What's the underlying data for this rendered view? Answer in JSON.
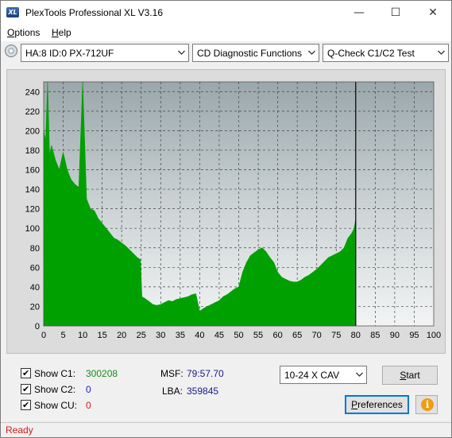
{
  "window": {
    "title": "PlexTools Professional XL V3.16",
    "icon_text": "XL",
    "controls": {
      "minimize": "—",
      "maximize": "☐",
      "close": "✕"
    }
  },
  "menu": {
    "items": [
      {
        "label_u": "O",
        "label_rest": "ptions"
      },
      {
        "label_u": "H",
        "label_rest": "elp"
      }
    ]
  },
  "toolbar": {
    "drive": "HA:8 ID:0  PX-712UF",
    "function": "CD Diagnostic Functions",
    "test": "Q-Check C1/C2 Test"
  },
  "chart_data": {
    "type": "area",
    "title": "",
    "xlabel": "",
    "ylabel": "",
    "xlim": [
      0,
      100
    ],
    "ylim": [
      0,
      250
    ],
    "x_ticks": [
      0,
      5,
      10,
      15,
      20,
      25,
      30,
      35,
      40,
      45,
      50,
      55,
      60,
      65,
      70,
      75,
      80,
      85,
      90,
      95,
      100
    ],
    "y_ticks": [
      0,
      20,
      40,
      60,
      80,
      100,
      120,
      140,
      160,
      180,
      200,
      220,
      240
    ],
    "grid": true,
    "end_marker_x": 80,
    "series": [
      {
        "color": "#00a000",
        "x": [
          0,
          0.5,
          1,
          1.5,
          2,
          3,
          4,
          5,
          6,
          7,
          8,
          9,
          10,
          11,
          12,
          13,
          14,
          15,
          16,
          17,
          18,
          19,
          20,
          21,
          22,
          23,
          24,
          24.8,
          25.2,
          26,
          27,
          28,
          29,
          30,
          31,
          32,
          33,
          34,
          35,
          36,
          37,
          38,
          39,
          40,
          41,
          42,
          43,
          44,
          45,
          46,
          47,
          48,
          49,
          50,
          51,
          52,
          53,
          54,
          55,
          56,
          57,
          58,
          59,
          60,
          61,
          62,
          63,
          64,
          65,
          66,
          67,
          68,
          69,
          70,
          71,
          72,
          73,
          74,
          75,
          76,
          77,
          78,
          79,
          79.6,
          80
        ],
        "y": [
          200,
          190,
          250,
          175,
          185,
          170,
          160,
          178,
          160,
          150,
          145,
          142,
          250,
          130,
          120,
          118,
          110,
          105,
          100,
          95,
          90,
          88,
          85,
          82,
          78,
          74,
          70,
          68,
          30,
          28,
          25,
          22,
          21,
          22,
          24,
          26,
          25,
          27,
          28,
          29,
          30,
          32,
          33,
          15,
          18,
          20,
          22,
          24,
          26,
          30,
          32,
          35,
          38,
          40,
          55,
          65,
          72,
          75,
          78,
          80,
          76,
          70,
          65,
          55,
          50,
          48,
          46,
          45,
          45,
          47,
          50,
          52,
          55,
          58,
          62,
          66,
          70,
          72,
          74,
          76,
          80,
          90,
          95,
          100,
          110
        ]
      }
    ]
  },
  "stats": {
    "c1": {
      "label": "Show C1:",
      "value": "300208",
      "checked": true
    },
    "c2": {
      "label": "Show C2:",
      "value": "0",
      "checked": true
    },
    "cu": {
      "label": "Show CU:",
      "value": "0",
      "checked": true
    },
    "msf_label": "MSF:",
    "msf_value": "79:57.70",
    "lba_label": "LBA:",
    "lba_value": "359845"
  },
  "controls": {
    "speed": "10-24 X CAV",
    "start_u": "S",
    "start_rest": "tart",
    "preferences_u": "P",
    "preferences_rest": "references",
    "info_icon": "i"
  },
  "status": {
    "text": "Ready"
  }
}
